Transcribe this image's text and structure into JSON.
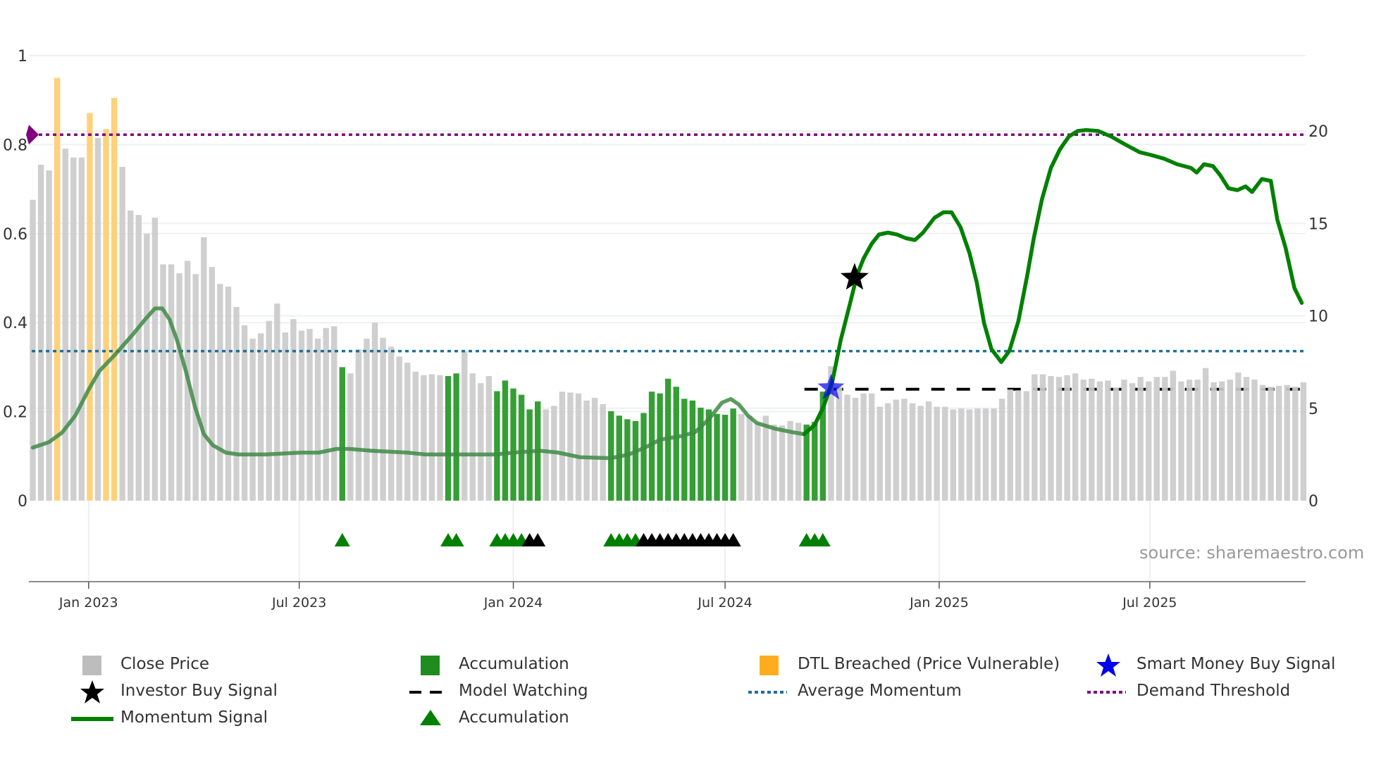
{
  "chart_data": {
    "type": "bar",
    "title": "",
    "source_label": "source: sharemaestro.com",
    "start_date": "2022-11-14",
    "bar_interval_days": 7,
    "left_axis": {
      "ylim": [
        0,
        1
      ],
      "ticks": [
        0,
        0.2,
        0.4,
        0.6,
        0.8,
        1
      ],
      "tick_labels": [
        "0",
        "0.2",
        "0.4",
        "0.6",
        "0.8",
        "1"
      ]
    },
    "right_axis": {
      "ylim": [
        0,
        24.05
      ],
      "ticks": [
        0,
        5,
        10,
        15,
        20
      ],
      "tick_labels": [
        "0",
        "5",
        "10",
        "15",
        "20"
      ]
    },
    "x_ticks": [
      {
        "date": "2023-01-01",
        "label": "Jan 2023"
      },
      {
        "date": "2023-07-01",
        "label": "Jul 2023"
      },
      {
        "date": "2024-01-01",
        "label": "Jan 2024"
      },
      {
        "date": "2024-07-01",
        "label": "Jul 2024"
      },
      {
        "date": "2025-01-01",
        "label": "Jan 2025"
      },
      {
        "date": "2025-07-01",
        "label": "Jul 2025"
      }
    ],
    "close_price_normalized": [
      0.676,
      0.755,
      0.742,
      0.95,
      0.791,
      0.771,
      0.771,
      0.871,
      0.815,
      0.835,
      0.905,
      0.75,
      0.652,
      0.642,
      0.6,
      0.636,
      0.531,
      0.531,
      0.511,
      0.539,
      0.509,
      0.592,
      0.525,
      0.487,
      0.481,
      0.435,
      0.394,
      0.364,
      0.376,
      0.404,
      0.443,
      0.378,
      0.408,
      0.382,
      0.386,
      0.364,
      0.388,
      0.392,
      0.3,
      0.286,
      0.34,
      0.364,
      0.4,
      0.366,
      0.346,
      0.324,
      0.31,
      0.29,
      0.282,
      0.284,
      0.282,
      0.28,
      0.286,
      0.336,
      0.286,
      0.264,
      0.28,
      0.246,
      0.27,
      0.252,
      0.238,
      0.205,
      0.223,
      0.205,
      0.213,
      0.245,
      0.243,
      0.241,
      0.225,
      0.231,
      0.217,
      0.201,
      0.191,
      0.183,
      0.179,
      0.197,
      0.245,
      0.241,
      0.274,
      0.256,
      0.229,
      0.225,
      0.209,
      0.205,
      0.195,
      0.193,
      0.207,
      0.195,
      0.191,
      0.175,
      0.191,
      0.171,
      0.169,
      0.179,
      0.175,
      0.171,
      0.177,
      0.245,
      0.302,
      0.256,
      0.238,
      0.231,
      0.241,
      0.241,
      0.211,
      0.219,
      0.227,
      0.229,
      0.219,
      0.213,
      0.223,
      0.211,
      0.211,
      0.205,
      0.207,
      0.205,
      0.207,
      0.207,
      0.207,
      0.229,
      0.25,
      0.248,
      0.246,
      0.284,
      0.284,
      0.28,
      0.278,
      0.282,
      0.286,
      0.272,
      0.274,
      0.268,
      0.27,
      0.254,
      0.272,
      0.264,
      0.278,
      0.268,
      0.278,
      0.278,
      0.292,
      0.268,
      0.272,
      0.272,
      0.298,
      0.266,
      0.268,
      0.272,
      0.288,
      0.278,
      0.272,
      0.26,
      0.256,
      0.258,
      0.26,
      0.256,
      0.266
    ],
    "accumulation_bar_weeks": [
      38,
      51,
      52,
      57,
      58,
      59,
      60,
      61,
      62,
      71,
      72,
      73,
      74,
      75,
      76,
      77,
      78,
      79,
      80,
      81,
      82,
      83,
      84,
      85,
      86,
      95,
      96,
      97
    ],
    "dtl_breached_bar_weeks": [
      3,
      7,
      9,
      10
    ],
    "momentum_signal": {
      "axis": "right",
      "active_from_week": 96,
      "points": [
        [
          0,
          2.87
        ],
        [
          1.96,
          3.16
        ],
        [
          3.59,
          3.68
        ],
        [
          5.22,
          4.6
        ],
        [
          6.85,
          6.0
        ],
        [
          8.15,
          7.0
        ],
        [
          10.1,
          7.9
        ],
        [
          12.3,
          9.0
        ],
        [
          13.9,
          9.86
        ],
        [
          15.0,
          10.4
        ],
        [
          15.9,
          10.4
        ],
        [
          16.8,
          9.8
        ],
        [
          17.7,
          8.7
        ],
        [
          18.8,
          7.0
        ],
        [
          19.9,
          5.1
        ],
        [
          21.0,
          3.6
        ],
        [
          22.1,
          3.0
        ],
        [
          23.7,
          2.6
        ],
        [
          25.3,
          2.5
        ],
        [
          28.6,
          2.5
        ],
        [
          32.9,
          2.6
        ],
        [
          35.1,
          2.6
        ],
        [
          37.3,
          2.8
        ],
        [
          38.9,
          2.8
        ],
        [
          41.6,
          2.7
        ],
        [
          46.0,
          2.6
        ],
        [
          48.2,
          2.5
        ],
        [
          52.5,
          2.5
        ],
        [
          56.8,
          2.5
        ],
        [
          59.0,
          2.6
        ],
        [
          62.3,
          2.7
        ],
        [
          64.5,
          2.6
        ],
        [
          67.2,
          2.35
        ],
        [
          71.0,
          2.3
        ],
        [
          73.2,
          2.5
        ],
        [
          75.3,
          2.9
        ],
        [
          77.0,
          3.3
        ],
        [
          79.7,
          3.5
        ],
        [
          81.3,
          3.7
        ],
        [
          83.0,
          4.4
        ],
        [
          84.6,
          5.3
        ],
        [
          85.7,
          5.5
        ],
        [
          86.7,
          5.2
        ],
        [
          87.8,
          4.6
        ],
        [
          88.9,
          4.2
        ],
        [
          91.1,
          3.9
        ],
        [
          93.3,
          3.7
        ],
        [
          94.7,
          3.6
        ],
        [
          96.0,
          4.1
        ],
        [
          97.1,
          5.1
        ],
        [
          98.2,
          6.5
        ],
        [
          99.2,
          8.7
        ],
        [
          100.3,
          10.6
        ],
        [
          101.2,
          12.2
        ],
        [
          102.0,
          13.1
        ],
        [
          103.0,
          13.9
        ],
        [
          103.9,
          14.4
        ],
        [
          105.0,
          14.5
        ],
        [
          106.1,
          14.4
        ],
        [
          107.2,
          14.2
        ],
        [
          108.3,
          14.1
        ],
        [
          109.3,
          14.5
        ],
        [
          110.7,
          15.3
        ],
        [
          111.8,
          15.6
        ],
        [
          112.8,
          15.6
        ],
        [
          113.9,
          14.8
        ],
        [
          115.0,
          13.4
        ],
        [
          115.9,
          11.8
        ],
        [
          116.8,
          9.6
        ],
        [
          117.7,
          8.2
        ],
        [
          118.9,
          7.5
        ],
        [
          119.9,
          8.1
        ],
        [
          121.0,
          9.7
        ],
        [
          122.1,
          12.2
        ],
        [
          122.9,
          14.2
        ],
        [
          123.9,
          16.3
        ],
        [
          125.0,
          18.0
        ],
        [
          126.1,
          19.0
        ],
        [
          127.2,
          19.7
        ],
        [
          128.3,
          20.0
        ],
        [
          129.3,
          20.05
        ],
        [
          130.8,
          20.0
        ],
        [
          132.4,
          19.7
        ],
        [
          134.0,
          19.3
        ],
        [
          135.9,
          18.85
        ],
        [
          137.3,
          18.7
        ],
        [
          138.9,
          18.5
        ],
        [
          140.5,
          18.2
        ],
        [
          142.2,
          18.0
        ],
        [
          142.9,
          17.75
        ],
        [
          143.8,
          18.2
        ],
        [
          144.9,
          18.1
        ],
        [
          145.8,
          17.6
        ],
        [
          146.8,
          16.9
        ],
        [
          147.9,
          16.8
        ],
        [
          148.9,
          17.0
        ],
        [
          149.7,
          16.7
        ],
        [
          150.9,
          17.4
        ],
        [
          152.0,
          17.3
        ],
        [
          152.8,
          15.2
        ],
        [
          153.8,
          13.7
        ],
        [
          154.9,
          11.5
        ],
        [
          155.8,
          10.7
        ]
      ]
    },
    "average_momentum": 8.09,
    "demand_threshold": 19.8,
    "model_watching": {
      "value": 6.03,
      "from_week": 95
    },
    "accumulation_triangles_green_weeks": [
      38,
      51,
      52,
      57,
      58,
      59,
      60,
      71,
      72,
      73,
      74,
      95,
      96,
      97
    ],
    "accumulation_triangles_black_weeks": [
      61,
      62,
      75,
      76,
      77,
      78,
      79,
      80,
      81,
      82,
      83,
      84,
      85,
      86
    ],
    "investor_buy_signal": {
      "week": 100.9,
      "value": 12.06
    },
    "smart_money_buy_signal": {
      "week": 98.0,
      "value": 6.1
    },
    "colors": {
      "close_price": "#cbcbcb",
      "accumulation": "#2a9a2a",
      "dtl": "#ffd17a",
      "momentum": "#008000",
      "momentum_inactive": "#3f8a46",
      "average_momentum": "#1f6f99",
      "demand_threshold": "#800080",
      "model_watching": "#000000",
      "investor_star": "#000000",
      "smart_money_star": "#0000ee"
    },
    "legend": [
      {
        "label": "Close Price",
        "icon": "gray-square-icon"
      },
      {
        "label": "Accumulation",
        "icon": "green-square-icon"
      },
      {
        "label": "DTL Breached (Price Vulnerable)",
        "icon": "orange-square-icon"
      },
      {
        "label": "Smart Money Buy Signal",
        "icon": "blue-star-icon"
      },
      {
        "label": "Investor Buy Signal",
        "icon": "black-star-icon"
      },
      {
        "label": "Model Watching",
        "icon": "dashed-line-icon"
      },
      {
        "label": "Average Momentum",
        "icon": "dotted-blue-line-icon"
      },
      {
        "label": "Demand Threshold",
        "icon": "dotted-purple-line-icon"
      },
      {
        "label": "Momentum Signal",
        "icon": "green-line-icon"
      },
      {
        "label": "Accumulation",
        "icon": "green-triangle-icon"
      }
    ]
  }
}
